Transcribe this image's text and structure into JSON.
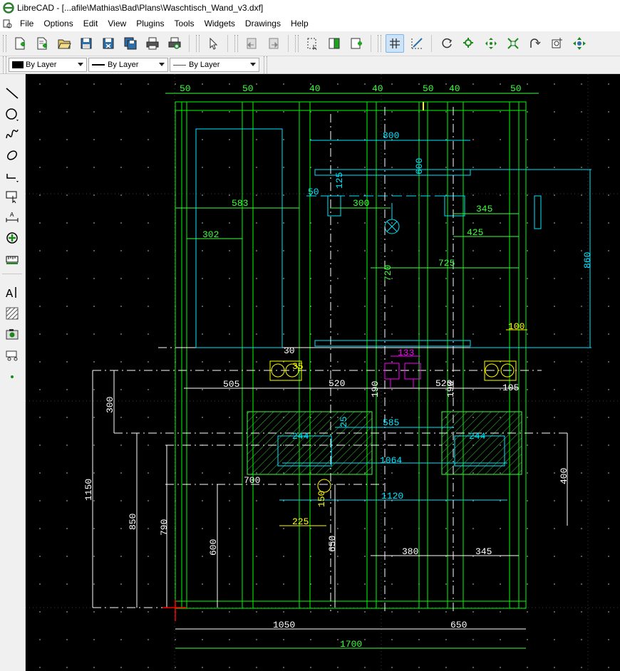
{
  "window": {
    "title": "LibreCAD - [...afile\\Mathias\\Bad\\Plans\\Waschtisch_Wand_v3.dxf]"
  },
  "menu": [
    "File",
    "Options",
    "Edit",
    "View",
    "Plugins",
    "Tools",
    "Widgets",
    "Drawings",
    "Help"
  ],
  "toolbar": {
    "file": [
      "new-file-icon",
      "new-from-template-icon",
      "open-file-icon",
      "save-file-icon",
      "save-as-icon",
      "save-all-icon",
      "print-icon",
      "print-preview-icon"
    ],
    "select": [
      "select-pointer-icon"
    ],
    "undo": [
      "undo-icon",
      "redo-icon"
    ],
    "edit": [
      "select-window-icon",
      "copy-icon",
      "paste-icon"
    ],
    "view": [
      "grid-toggle-icon",
      "draft-mode-icon",
      "redraw-icon",
      "zoom-in-icon",
      "zoom-out-icon",
      "zoom-auto-icon",
      "zoom-previous-icon",
      "zoom-window-icon",
      "zoom-pan-icon"
    ]
  },
  "pen": {
    "color_label": "By Layer",
    "line_type_label": "By Layer",
    "line_width_label": "By Layer"
  },
  "left_tools": [
    "line-tool-icon",
    "circle-tool-icon",
    "spline-tool-icon",
    "ellipse-tool-icon",
    "polyline-tool-icon",
    "select-tool-icon",
    "dimension-tool-icon",
    "modify-tool-icon",
    "measure-tool-icon",
    "text-tool-icon",
    "hatch-tool-icon",
    "image-tool-icon",
    "block-tool-icon",
    "point-tool-icon"
  ],
  "colors": {
    "geometry": "#00ff00",
    "dimension_cyan": "#00e5ff",
    "dimension_green": "#3cff3c",
    "highlight_yellow": "#ffff00",
    "magenta": "#ff00ff",
    "white": "#ffffff",
    "background": "#000000"
  },
  "dims": {
    "top_50a": "50",
    "top_50b": "50",
    "top_40a": "40",
    "top_40b": "40",
    "top_50c": "50",
    "top_40c": "40",
    "top_50d": "50",
    "d800": "800",
    "d600": "600",
    "d50": "50",
    "d125": "125",
    "d583": "583",
    "d300": "300",
    "d345": "345",
    "d425": "425",
    "d302": "302",
    "d725": "725",
    "d720": "720",
    "d860": "860",
    "d100": "100",
    "d30": "30",
    "d35": "35",
    "d133": "133",
    "d505": "505",
    "d520": "520",
    "d520b": "520",
    "d190": "190",
    "d190b": "190",
    "d105": "105",
    "d300v": "300",
    "d25": "25",
    "d585": "585",
    "d244a": "244",
    "d244b": "244",
    "d1064": "1064",
    "d400": "400",
    "d700": "700",
    "d1150": "1150",
    "d1120": "1120",
    "d850": "850",
    "d150": "150",
    "d225": "225",
    "d790": "790",
    "d600v": "600",
    "d650v": "650",
    "d380": "380",
    "d345b": "345",
    "d1050": "1050",
    "d650": "650",
    "d1700": "1700"
  }
}
